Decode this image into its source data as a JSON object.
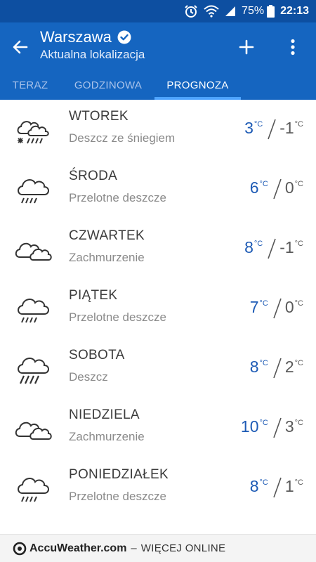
{
  "status_bar": {
    "battery": "75%",
    "time": "22:13"
  },
  "header": {
    "city": "Warszawa",
    "subtitle": "Aktualna lokalizacja"
  },
  "tabs": [
    {
      "label": "TERAZ",
      "active": false
    },
    {
      "label": "GODZINOWA",
      "active": false
    },
    {
      "label": "PROGNOZA",
      "active": true
    }
  ],
  "colors": {
    "app_bar": "#1565c0",
    "status_bar": "#0d4fa1",
    "accent": "#4da3ff",
    "high_temp": "#1e5bb5"
  },
  "unit": "°C",
  "forecast": [
    {
      "day": "WTOREK",
      "condition": "Deszcz ze śniegiem",
      "high": "3",
      "low": "-1",
      "icon": "rain-snow-icon"
    },
    {
      "day": "ŚRODA",
      "condition": "Przelotne deszcze",
      "high": "6",
      "low": "0",
      "icon": "rain-cloud-icon"
    },
    {
      "day": "CZWARTEK",
      "condition": "Zachmurzenie",
      "high": "8",
      "low": "-1",
      "icon": "clouds-icon"
    },
    {
      "day": "PIĄTEK",
      "condition": "Przelotne deszcze",
      "high": "7",
      "low": "0",
      "icon": "rain-cloud-icon"
    },
    {
      "day": "SOBOTA",
      "condition": "Deszcz",
      "high": "8",
      "low": "2",
      "icon": "heavy-rain-icon"
    },
    {
      "day": "NIEDZIELA",
      "condition": "Zachmurzenie",
      "high": "10",
      "low": "3",
      "icon": "clouds-icon"
    },
    {
      "day": "PONIEDZIAŁEK",
      "condition": "Przelotne deszcze",
      "high": "8",
      "low": "1",
      "icon": "rain-cloud-icon"
    }
  ],
  "footer": {
    "brand": "AccuWeather.com",
    "separator": "–",
    "more": "WIĘCEJ ONLINE"
  }
}
